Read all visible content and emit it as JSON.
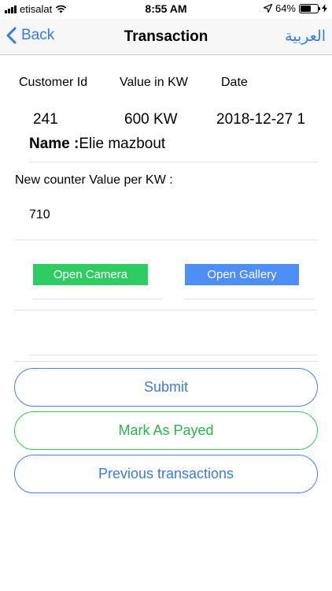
{
  "status_bar": {
    "carrier": "etisalat",
    "time": "8:55 AM",
    "battery_percent": "64%",
    "battery_level": 0.64
  },
  "nav": {
    "back_label": "Back",
    "title": "Transaction",
    "language_label": "العربية"
  },
  "transaction": {
    "headers": {
      "customer_id": "Customer Id",
      "value": "Value in KW",
      "date": "Date"
    },
    "customer_id": "241",
    "value": "600 KW",
    "date": "2018-12-27 1",
    "name_label": "Name :",
    "name_value": "Elie mazbout"
  },
  "counter": {
    "label": "New counter Value per KW :",
    "value": "710"
  },
  "photo_buttons": {
    "camera": "Open Camera",
    "gallery": "Open Gallery"
  },
  "actions": {
    "submit": "Submit",
    "mark_payed": "Mark As Payed",
    "previous": "Previous transactions"
  },
  "colors": {
    "accent_blue": "#3478f6",
    "camera_green": "#2ecc62",
    "gallery_blue": "#4e8ef7",
    "payed_green": "#27b548"
  }
}
